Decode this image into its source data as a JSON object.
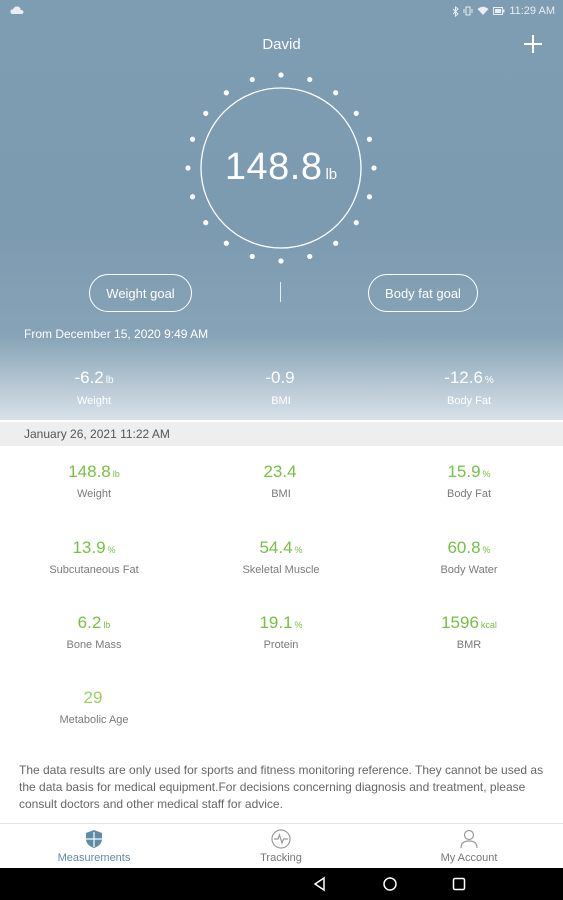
{
  "statusbar": {
    "time": "11:29 AM"
  },
  "header": {
    "user_name": "David"
  },
  "current": {
    "weight_value": "148.8",
    "weight_unit": "lb"
  },
  "goals": {
    "weight_goal_label": "Weight goal",
    "body_fat_goal_label": "Body fat goal"
  },
  "since": {
    "label": "From December 15, 2020 9:49 AM"
  },
  "changes": [
    {
      "value": "-6.2",
      "unit": "lb",
      "label": "Weight"
    },
    {
      "value": "-0.9",
      "unit": "",
      "label": "BMI"
    },
    {
      "value": "-12.6",
      "unit": "%",
      "label": "Body Fat"
    }
  ],
  "measurement_date": "January 26, 2021 11:22 AM",
  "metrics": [
    {
      "value": "148.8",
      "unit": "lb",
      "label": "Weight"
    },
    {
      "value": "23.4",
      "unit": "",
      "label": "BMI"
    },
    {
      "value": "15.9",
      "unit": "%",
      "label": "Body Fat"
    },
    {
      "value": "13.9",
      "unit": "%",
      "label": "Subcutaneous Fat"
    },
    {
      "value": "54.4",
      "unit": "%",
      "label": "Skeletal Muscle"
    },
    {
      "value": "60.8",
      "unit": "%",
      "label": "Body Water"
    },
    {
      "value": "6.2",
      "unit": "lb",
      "label": "Bone Mass"
    },
    {
      "value": "19.1",
      "unit": "%",
      "label": "Protein"
    },
    {
      "value": "1596",
      "unit": "kcal",
      "label": "BMR"
    },
    {
      "value": "29",
      "unit": "",
      "label": "Metabolic Age"
    }
  ],
  "disclaimer": "The data results are only used for sports and fitness monitoring reference. They cannot be used as the data basis for medical equipment.For decisions concerning diagnosis and treatment, please consult doctors and other medical staff for advice.",
  "tabs": [
    {
      "label": "Measurements",
      "icon": "shield-icon",
      "active": true
    },
    {
      "label": "Tracking",
      "icon": "pulse-icon",
      "active": false
    },
    {
      "label": "My Account",
      "icon": "person-icon",
      "active": false
    }
  ],
  "colors": {
    "header_bg": "#7e9cb2",
    "metric_green": "#76c043",
    "active_tab": "#5f8ba6"
  }
}
